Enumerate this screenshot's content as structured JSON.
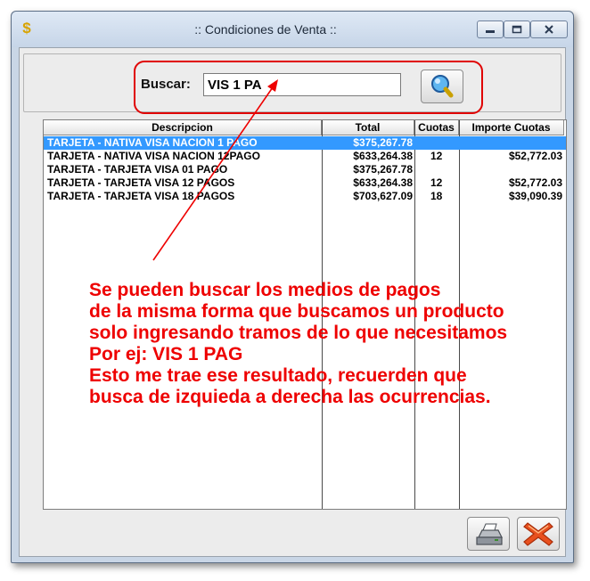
{
  "window": {
    "title": ":: Condiciones de Venta ::",
    "min_label": "▭",
    "max_label": "▢",
    "close_label": "✕"
  },
  "search": {
    "label": "Buscar:",
    "value": "VIS 1 PA",
    "button_icon": "magnifier-icon"
  },
  "table": {
    "columns": [
      "Descripcion",
      "Total",
      "Cuotas",
      "Importe Cuotas"
    ],
    "rows": [
      {
        "descripcion": "TARJETA - NATIVA VISA NACION 1 PAGO",
        "total": "$375,267.78",
        "cuotas": "",
        "importe": "",
        "selected": true
      },
      {
        "descripcion": "TARJETA - NATIVA VISA NACION 12PAGO",
        "total": "$633,264.38",
        "cuotas": "12",
        "importe": "$52,772.03",
        "selected": false
      },
      {
        "descripcion": "TARJETA - TARJETA VISA 01 PAGO",
        "total": "$375,267.78",
        "cuotas": "",
        "importe": "",
        "selected": false
      },
      {
        "descripcion": "TARJETA - TARJETA VISA 12 PAGOS",
        "total": "$633,264.38",
        "cuotas": "12",
        "importe": "$52,772.03",
        "selected": false
      },
      {
        "descripcion": "TARJETA - TARJETA VISA 18 PAGOS",
        "total": "$703,627.09",
        "cuotas": "18",
        "importe": "$39,090.39",
        "selected": false
      }
    ]
  },
  "annotation": {
    "lines": [
      "Se pueden buscar los medios de pagos",
      "de la misma forma que buscamos un producto",
      "solo ingresando tramos de lo que necesitamos",
      "Por ej: VIS 1 PAG",
      "Esto me trae ese resultado, recuerden que",
      "busca de izquieda a derecha las ocurrencias."
    ]
  },
  "colors": {
    "annotation": "#ee0000",
    "selection": "#3399ff",
    "window_frame": "#c9d6e6"
  },
  "buttons": {
    "print_icon": "printer-icon",
    "cancel_icon": "red-x-icon"
  }
}
